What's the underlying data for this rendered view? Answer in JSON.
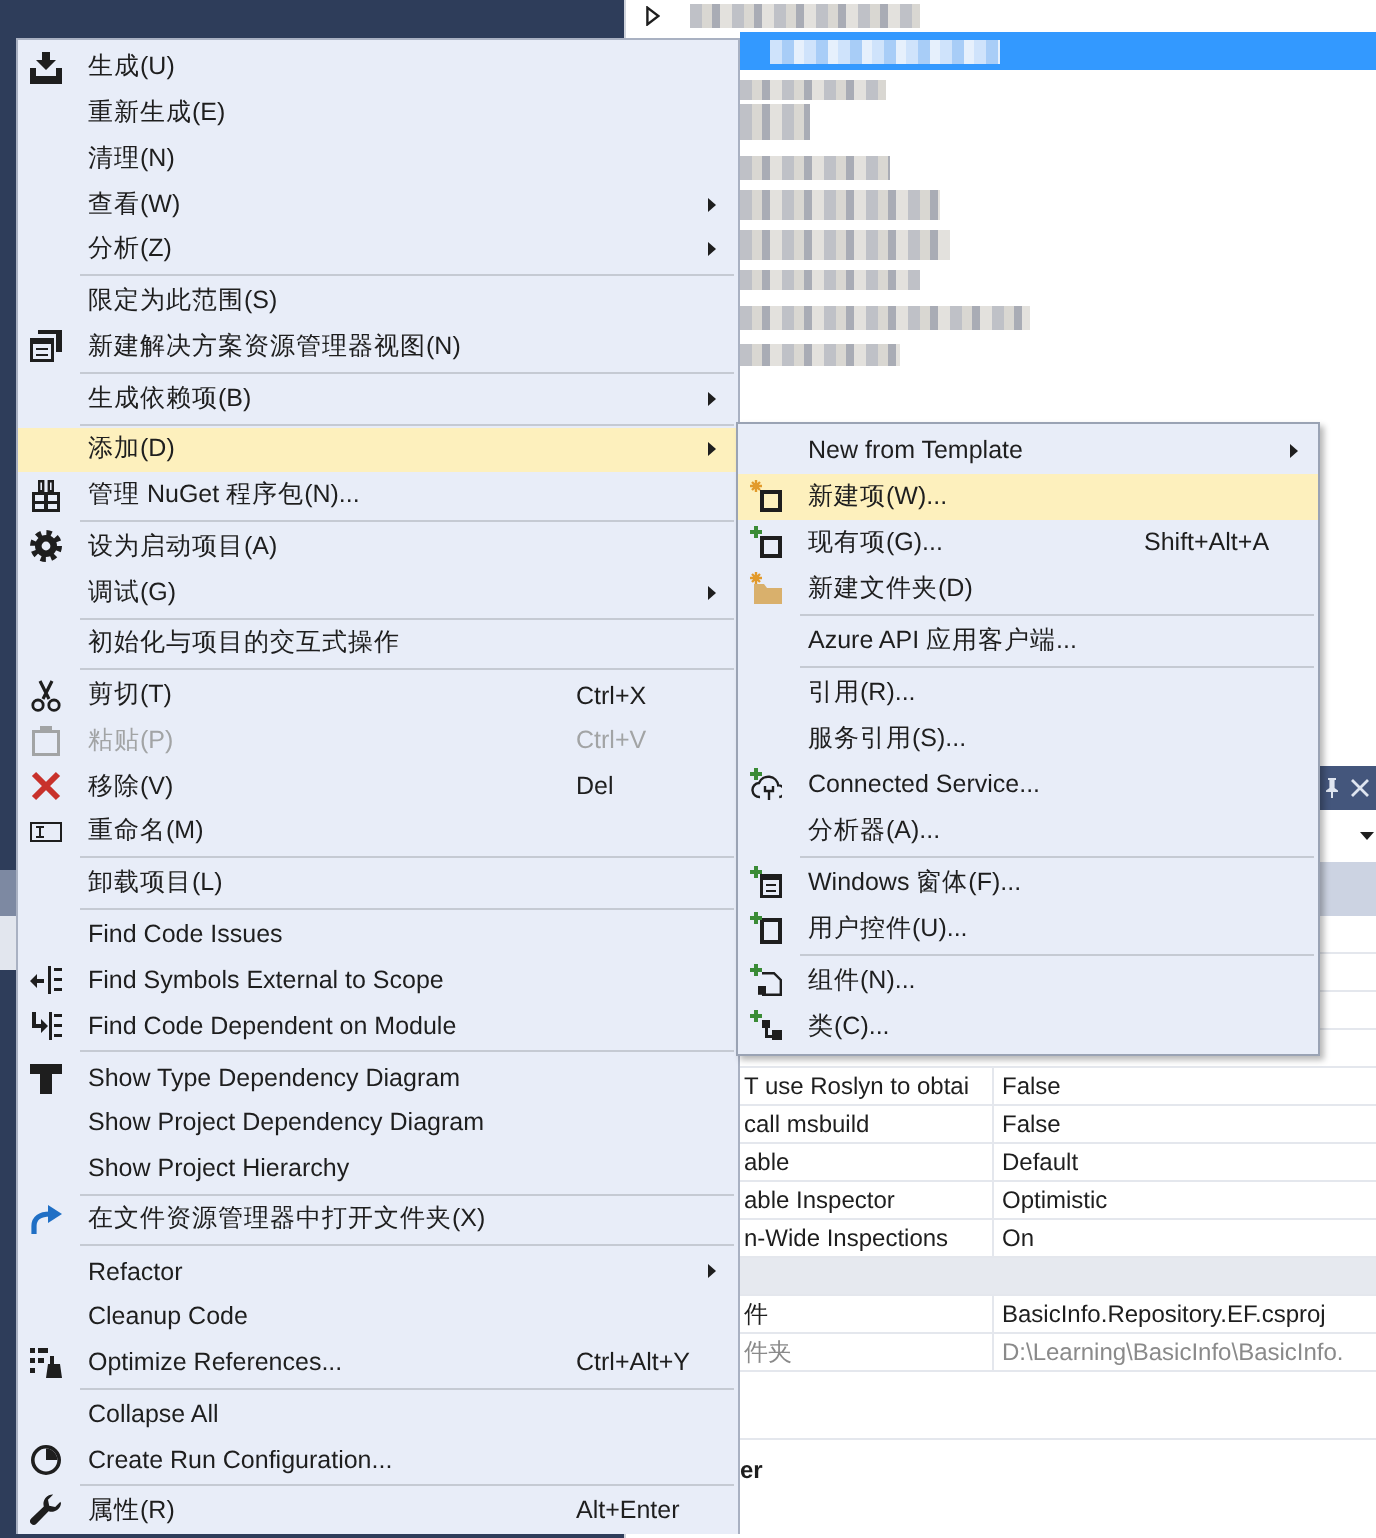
{
  "context_menu": {
    "items": [
      {
        "kind": "item",
        "label": "生成(U)",
        "has_submenu": false,
        "selected": false,
        "disabled": false
      },
      {
        "kind": "item",
        "label": "重新生成(E)",
        "has_submenu": false,
        "selected": false,
        "disabled": false
      },
      {
        "kind": "item",
        "label": "清理(N)",
        "has_submenu": false,
        "selected": false,
        "disabled": false
      },
      {
        "kind": "item",
        "label": "查看(W)",
        "has_submenu": true,
        "selected": false,
        "disabled": false
      },
      {
        "kind": "item",
        "label": "分析(Z)",
        "has_submenu": true,
        "selected": false,
        "disabled": false
      },
      {
        "kind": "separator"
      },
      {
        "kind": "item",
        "label": "限定为此范围(S)",
        "has_submenu": false,
        "selected": false,
        "disabled": false
      },
      {
        "kind": "item",
        "label": "新建解决方案资源管理器视图(N)",
        "has_submenu": false,
        "selected": false,
        "disabled": false
      },
      {
        "kind": "separator"
      },
      {
        "kind": "item",
        "label": "生成依赖项(B)",
        "has_submenu": true,
        "selected": false,
        "disabled": false
      },
      {
        "kind": "separator"
      },
      {
        "kind": "item",
        "label": "添加(D)",
        "has_submenu": true,
        "selected": true,
        "disabled": false
      },
      {
        "kind": "item",
        "label": "管理 NuGet 程序包(N)...",
        "has_submenu": false,
        "selected": false,
        "disabled": false
      },
      {
        "kind": "separator"
      },
      {
        "kind": "item",
        "label": "设为启动项目(A)",
        "has_submenu": false,
        "selected": false,
        "disabled": false
      },
      {
        "kind": "item",
        "label": "调试(G)",
        "has_submenu": true,
        "selected": false,
        "disabled": false
      },
      {
        "kind": "separator"
      },
      {
        "kind": "item",
        "label": "初始化与项目的交互式操作",
        "has_submenu": false,
        "selected": false,
        "disabled": false
      },
      {
        "kind": "separator"
      },
      {
        "kind": "item",
        "label": "剪切(T)",
        "shortcut": "Ctrl+X",
        "has_submenu": false,
        "selected": false,
        "disabled": false
      },
      {
        "kind": "item",
        "label": "粘贴(P)",
        "shortcut": "Ctrl+V",
        "has_submenu": false,
        "selected": false,
        "disabled": true
      },
      {
        "kind": "item",
        "label": "移除(V)",
        "shortcut": "Del",
        "has_submenu": false,
        "selected": false,
        "disabled": false
      },
      {
        "kind": "item",
        "label": "重命名(M)",
        "has_submenu": false,
        "selected": false,
        "disabled": false
      },
      {
        "kind": "separator"
      },
      {
        "kind": "item",
        "label": "卸载项目(L)",
        "has_submenu": false,
        "selected": false,
        "disabled": false
      },
      {
        "kind": "separator"
      },
      {
        "kind": "item",
        "label": "Find Code Issues",
        "has_submenu": false,
        "selected": false,
        "disabled": false
      },
      {
        "kind": "item",
        "label": "Find Symbols External to Scope",
        "has_submenu": false,
        "selected": false,
        "disabled": false
      },
      {
        "kind": "item",
        "label": "Find Code Dependent on Module",
        "has_submenu": false,
        "selected": false,
        "disabled": false
      },
      {
        "kind": "separator"
      },
      {
        "kind": "item",
        "label": "Show Type Dependency Diagram",
        "has_submenu": false,
        "selected": false,
        "disabled": false
      },
      {
        "kind": "item",
        "label": "Show Project Dependency Diagram",
        "has_submenu": false,
        "selected": false,
        "disabled": false
      },
      {
        "kind": "item",
        "label": "Show Project Hierarchy",
        "has_submenu": false,
        "selected": false,
        "disabled": false
      },
      {
        "kind": "separator"
      },
      {
        "kind": "item",
        "label": "在文件资源管理器中打开文件夹(X)",
        "has_submenu": false,
        "selected": false,
        "disabled": false
      },
      {
        "kind": "separator"
      },
      {
        "kind": "item",
        "label": "Refactor",
        "has_submenu": true,
        "selected": false,
        "disabled": false
      },
      {
        "kind": "item",
        "label": "Cleanup Code",
        "has_submenu": false,
        "selected": false,
        "disabled": false
      },
      {
        "kind": "item",
        "label": "Optimize References...",
        "shortcut": "Ctrl+Alt+Y",
        "has_submenu": false,
        "selected": false,
        "disabled": false
      },
      {
        "kind": "separator"
      },
      {
        "kind": "item",
        "label": "Collapse All",
        "has_submenu": false,
        "selected": false,
        "disabled": false
      },
      {
        "kind": "item",
        "label": "Create Run Configuration...",
        "has_submenu": false,
        "selected": false,
        "disabled": false
      },
      {
        "kind": "separator"
      },
      {
        "kind": "item",
        "label": "属性(R)",
        "shortcut": "Alt+Enter",
        "has_submenu": false,
        "selected": false,
        "disabled": false
      }
    ]
  },
  "add_submenu": {
    "items": [
      {
        "kind": "item",
        "label": "New from Template",
        "has_submenu": true,
        "selected": false,
        "disabled": false
      },
      {
        "kind": "item",
        "label": "新建项(W)...",
        "has_submenu": false,
        "selected": true,
        "disabled": false
      },
      {
        "kind": "item",
        "label": "现有项(G)...",
        "shortcut": "Shift+Alt+A",
        "has_submenu": false,
        "selected": false,
        "disabled": false
      },
      {
        "kind": "item",
        "label": "新建文件夹(D)",
        "has_submenu": false,
        "selected": false,
        "disabled": false
      },
      {
        "kind": "separator"
      },
      {
        "kind": "item",
        "label": "Azure API 应用客户端...",
        "has_submenu": false,
        "selected": false,
        "disabled": false
      },
      {
        "kind": "separator"
      },
      {
        "kind": "item",
        "label": "引用(R)...",
        "has_submenu": false,
        "selected": false,
        "disabled": false
      },
      {
        "kind": "item",
        "label": "服务引用(S)...",
        "has_submenu": false,
        "selected": false,
        "disabled": false
      },
      {
        "kind": "item",
        "label": "Connected Service...",
        "has_submenu": false,
        "selected": false,
        "disabled": false
      },
      {
        "kind": "item",
        "label": "分析器(A)...",
        "has_submenu": false,
        "selected": false,
        "disabled": false
      },
      {
        "kind": "separator"
      },
      {
        "kind": "item",
        "label": "Windows 窗体(F)...",
        "has_submenu": false,
        "selected": false,
        "disabled": false
      },
      {
        "kind": "item",
        "label": "用户控件(U)...",
        "has_submenu": false,
        "selected": false,
        "disabled": false
      },
      {
        "kind": "separator"
      },
      {
        "kind": "item",
        "label": "组件(N)...",
        "has_submenu": false,
        "selected": false,
        "disabled": false
      },
      {
        "kind": "item",
        "label": "类(C)...",
        "has_submenu": false,
        "selected": false,
        "disabled": false
      }
    ]
  },
  "properties": {
    "rows": [
      {
        "kind": "property",
        "name": "T use Roslyn to obtai",
        "value": "False",
        "readonly": false
      },
      {
        "kind": "property",
        "name": "call msbuild",
        "value": "False",
        "readonly": false
      },
      {
        "kind": "property",
        "name": "able",
        "value": "Default",
        "readonly": false
      },
      {
        "kind": "property",
        "name": "able Inspector",
        "value": "Optimistic",
        "readonly": false
      },
      {
        "kind": "property",
        "name": "n-Wide Inspections",
        "value": "On",
        "readonly": false
      },
      {
        "kind": "category"
      },
      {
        "kind": "property",
        "name": "件",
        "value": "BasicInfo.Repository.EF.csproj",
        "readonly": false
      },
      {
        "kind": "property",
        "name": "件夹",
        "value": "D:\\Learning\\BasicInfo\\BasicInfo.",
        "readonly": true
      }
    ],
    "description_title": "er"
  }
}
